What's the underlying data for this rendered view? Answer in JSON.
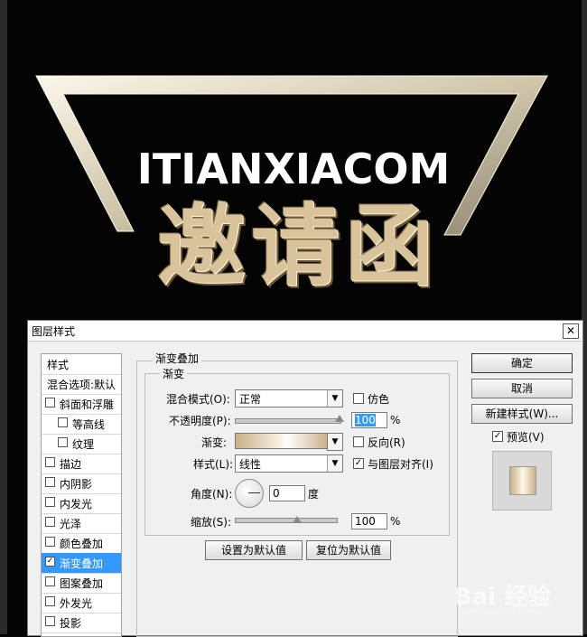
{
  "artwork": {
    "headline_en": "ITIANXIACOM",
    "headline_cn": "邀请函"
  },
  "dialog": {
    "title": "图层样式",
    "close_symbol": "✕",
    "styles_list": {
      "header": "样式",
      "blend_options": "混合选项:默认",
      "items": [
        {
          "label": "斜面和浮雕",
          "checked": false,
          "selected": false
        },
        {
          "label": "等高线",
          "checked": false,
          "selected": false
        },
        {
          "label": "纹理",
          "checked": false,
          "selected": false
        },
        {
          "label": "描边",
          "checked": false,
          "selected": false
        },
        {
          "label": "内阴影",
          "checked": false,
          "selected": false
        },
        {
          "label": "内发光",
          "checked": false,
          "selected": false
        },
        {
          "label": "光泽",
          "checked": false,
          "selected": false
        },
        {
          "label": "颜色叠加",
          "checked": false,
          "selected": false
        },
        {
          "label": "渐变叠加",
          "checked": true,
          "selected": true
        },
        {
          "label": "图案叠加",
          "checked": false,
          "selected": false
        },
        {
          "label": "外发光",
          "checked": false,
          "selected": false
        },
        {
          "label": "投影",
          "checked": false,
          "selected": false
        }
      ]
    },
    "gradient_overlay": {
      "section_title": "渐变叠加",
      "group_title": "渐变",
      "blend_mode_label": "混合模式(O):",
      "blend_mode_value": "正常",
      "dither_label": "仿色",
      "dither_checked": false,
      "opacity_label": "不透明度(P):",
      "opacity_value": "100",
      "opacity_percent": 1.0,
      "percent_sign": "%",
      "gradient_label": "渐变:",
      "reverse_label": "反向(R)",
      "reverse_checked": false,
      "style_label": "样式(L):",
      "style_value": "线性",
      "align_label": "与图层对齐(I)",
      "align_checked": true,
      "angle_label": "角度(N):",
      "angle_value": "0",
      "angle_unit": "度",
      "scale_label": "缩放(S):",
      "scale_value": "100",
      "scale_percent": 1.0,
      "make_default": "设置为默认值",
      "reset_default": "复位为默认值"
    },
    "buttons": {
      "ok": "确定",
      "cancel": "取消",
      "new_style": "新建样式(W)...",
      "preview_label": "预览(V)",
      "preview_checked": true
    }
  },
  "watermark": {
    "text": "Bai 经验",
    "sub": "jingyan.baidu.com"
  },
  "colors": {
    "selection": "#3399ff",
    "gold": "#d8c39a"
  }
}
